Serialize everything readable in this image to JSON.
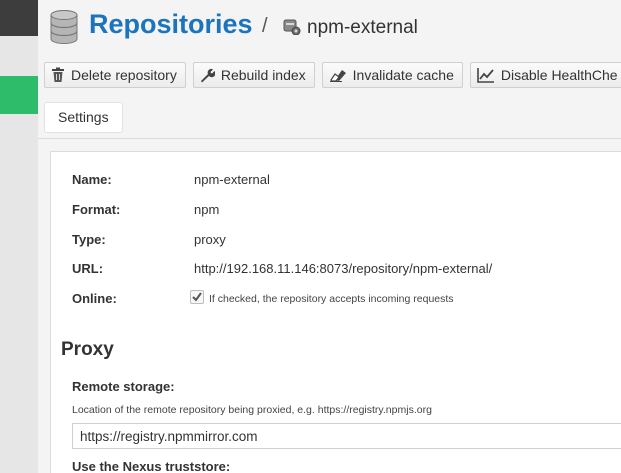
{
  "header": {
    "title": "Repositories",
    "separator": "/",
    "repo_name": "npm-external"
  },
  "toolbar": {
    "delete_label": "Delete repository",
    "rebuild_label": "Rebuild index",
    "invalidate_label": "Invalidate cache",
    "health_label": "Disable HealthChe"
  },
  "tabs": [
    {
      "label": "Settings",
      "active": true
    }
  ],
  "details": {
    "name_label": "Name:",
    "name_value": "npm-external",
    "format_label": "Format:",
    "format_value": "npm",
    "type_label": "Type:",
    "type_value": "proxy",
    "url_label": "URL:",
    "url_value": "http://192.168.11.146:8073/repository/npm-external/",
    "online_label": "Online:",
    "online_checked": true,
    "online_help": "If checked, the repository accepts incoming requests"
  },
  "proxy": {
    "section_title": "Proxy",
    "remote_label": "Remote storage:",
    "remote_help": "Location of the remote repository being proxied, e.g. https://registry.npmjs.org",
    "remote_value": "https://registry.npmmirror.com",
    "truststore_label": "Use the Nexus truststore:"
  },
  "colors": {
    "accent": "#1c75bc",
    "sidebar_dark": "#3d3d3d",
    "sidebar_active": "#2ebc6b"
  }
}
